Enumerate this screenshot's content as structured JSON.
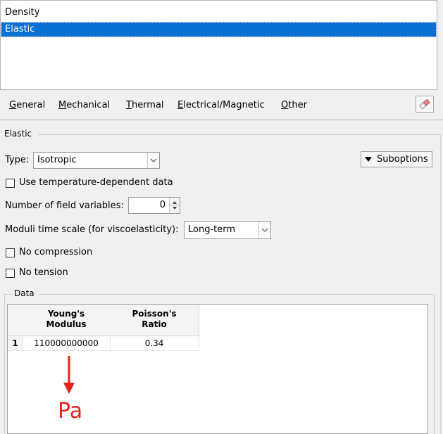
{
  "behaviors": {
    "items": [
      {
        "label": "Density",
        "selected": false
      },
      {
        "label": "Elastic",
        "selected": true
      }
    ]
  },
  "menu": {
    "general": {
      "mnemonic": "G",
      "rest": "eneral"
    },
    "mechanical": {
      "mnemonic": "M",
      "rest": "echanical"
    },
    "thermal": {
      "mnemonic": "T",
      "rest": "hermal"
    },
    "electrical": {
      "mnemonic": "E",
      "rest": "lectrical/Magnetic"
    },
    "other": {
      "mnemonic": "O",
      "rest": "ther"
    },
    "eraser_icon": "eraser-icon"
  },
  "elastic": {
    "title": "Elastic",
    "type_label": "Type:",
    "type_value": "Isotropic",
    "suboptions_label": "Suboptions",
    "temp_dependent_label": "Use temperature-dependent data",
    "temp_dependent_checked": false,
    "field_vars_label": "Number of field variables:",
    "field_vars_value": "0",
    "moduli_label": "Moduli time scale (for viscoelasticity):",
    "moduli_value": "Long-term",
    "no_compression_label": "No compression",
    "no_compression_checked": false,
    "no_tension_label": "No tension",
    "no_tension_checked": false
  },
  "data": {
    "title": "Data",
    "columns": [
      {
        "line1": "Young's",
        "line2": "Modulus"
      },
      {
        "line1": "Poisson's",
        "line2": "Ratio"
      }
    ],
    "rows": [
      {
        "index": "1",
        "youngs": "110000000000",
        "poisson": "0.34"
      }
    ]
  },
  "annotation": {
    "text": "Pa",
    "color": "#e8231b"
  },
  "colors": {
    "selection": "#0a6fd3",
    "annotation": "#e8231b"
  }
}
